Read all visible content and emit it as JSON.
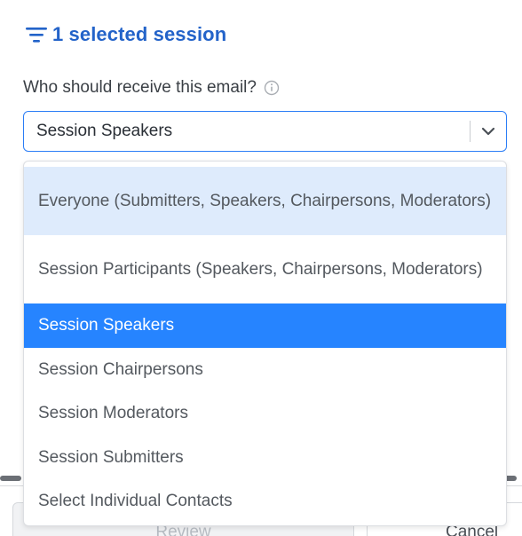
{
  "filter": {
    "label": "1 selected session",
    "icon": "filter-lines-icon"
  },
  "question": {
    "label": "Who should receive this email?",
    "icon": "info-circle-icon"
  },
  "select": {
    "value": "Session Speakers",
    "icon": "chevron-down-icon"
  },
  "menu": {
    "options": [
      {
        "label": "Everyone (Submitters, Speakers, Chairpersons, Moderators)",
        "state": "hovered"
      },
      {
        "label": "Session Participants (Speakers, Chairpersons, Moderators)",
        "state": ""
      },
      {
        "label": "Session Speakers",
        "state": "selected"
      },
      {
        "label": "Session Chairpersons",
        "state": ""
      },
      {
        "label": "Session Moderators",
        "state": ""
      },
      {
        "label": "Session Submitters",
        "state": ""
      },
      {
        "label": "Select Individual Contacts",
        "state": ""
      }
    ]
  },
  "footer": {
    "review_label": "Review",
    "cancel_label": "Cancel"
  },
  "colors": {
    "accent": "#2684ff",
    "hover": "#deebfc",
    "link": "#2363c9",
    "border_focus": "#2b7df6"
  }
}
